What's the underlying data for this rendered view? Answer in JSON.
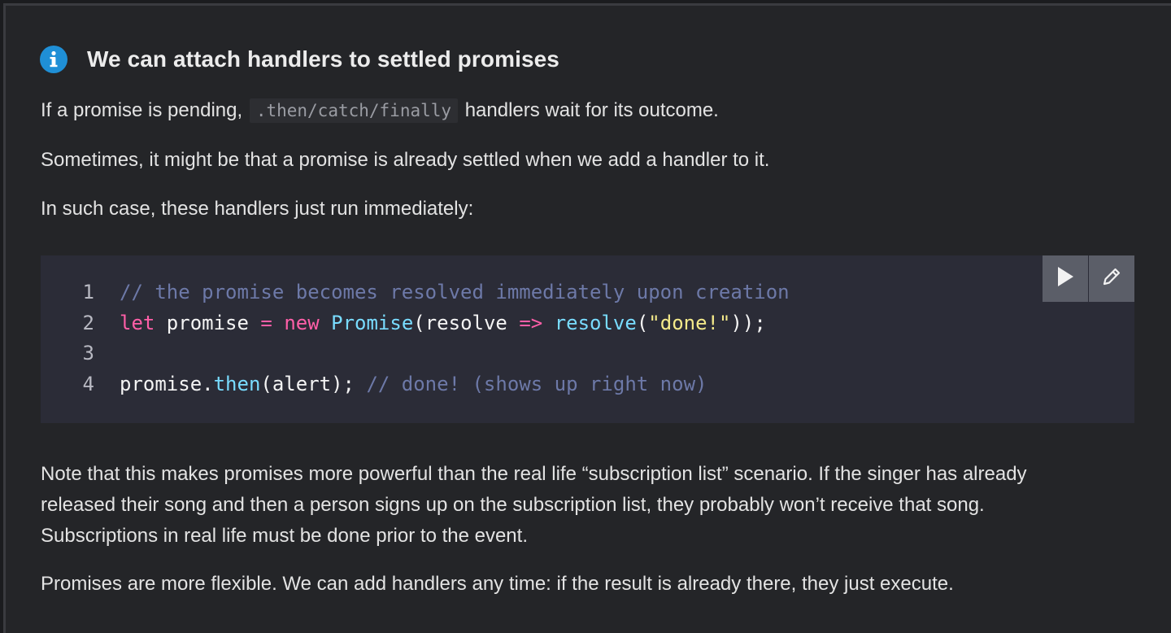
{
  "notice": {
    "icon": "info-icon",
    "accent_color": "#1f8fd6",
    "title": "We can attach handlers to settled promises"
  },
  "paragraphs": {
    "p1_before": "If a promise is pending,",
    "p1_code": ".then/catch/finally",
    "p1_after": "handlers wait for its outcome.",
    "p2": "Sometimes, it might be that a promise is already settled when we add a handler to it.",
    "p3": "In such case, these handlers just run immediately:",
    "p4_line1": "Note that this makes promises more powerful than the real life “subscription list” scenario. If the singer has already",
    "p4_line2": "released their song and then a person signs up on the subscription list, they probably won’t receive that song.",
    "p4_line3": "Subscriptions in real life must be done prior to the event.",
    "p5": "Promises are more flexible. We can add handlers any time: if the result is already there, they just execute."
  },
  "code": {
    "line_numbers": [
      "1",
      "2",
      "3",
      "4"
    ],
    "line1": {
      "comment": "// the promise becomes resolved immediately upon creation"
    },
    "line2": {
      "kw_let": "let",
      "var": " promise ",
      "eq": "=",
      "sp1": " ",
      "kw_new": "new",
      "sp2": " ",
      "cls": "Promise",
      "open": "(resolve ",
      "arrow": "=>",
      "sp3": " ",
      "fn": "resolve",
      "paren": "(",
      "str": "\"done!\"",
      "close": "));"
    },
    "line4": {
      "obj": "promise.",
      "method": "then",
      "args": "(alert); ",
      "comment": "// done! (shows up right now)"
    },
    "toolbar": {
      "run_icon": "play-icon",
      "edit_icon": "pencil-icon"
    }
  }
}
